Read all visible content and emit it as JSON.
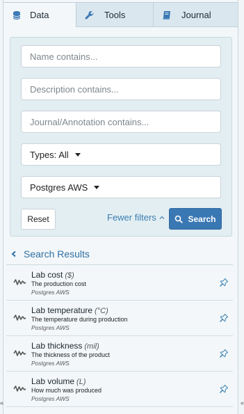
{
  "tabs": [
    {
      "label": "Data",
      "icon": "database-icon",
      "active": true
    },
    {
      "label": "Tools",
      "icon": "wrench-icon",
      "active": false
    },
    {
      "label": "Journal",
      "icon": "book-icon",
      "active": false
    }
  ],
  "filters": {
    "name_placeholder": "Name contains...",
    "name_value": "",
    "description_placeholder": "Description contains...",
    "description_value": "",
    "journal_placeholder": "Journal/Annotation contains...",
    "journal_value": "",
    "types_label": "Types: All",
    "source_label": "Postgres AWS",
    "reset_label": "Reset",
    "fewer_filters_label": "Fewer filters",
    "search_label": "Search"
  },
  "results": {
    "heading": "Search Results",
    "items": [
      {
        "name": "Lab cost",
        "unit": "($)",
        "description": "The production cost",
        "source": "Postgres AWS"
      },
      {
        "name": "Lab temperature",
        "unit": "(°C)",
        "description": "The temperature during production",
        "source": "Postgres AWS"
      },
      {
        "name": "Lab thickness",
        "unit": "(mil)",
        "description": "The thickness of the product",
        "source": "Postgres AWS"
      },
      {
        "name": "Lab volume",
        "unit": "(L)",
        "description": "How much was produced",
        "source": "Postgres AWS"
      }
    ]
  },
  "edges": {
    "left": "«",
    "right": "«"
  },
  "colors": {
    "accent": "#3a78b4",
    "link": "#3b7fb2",
    "panel": "#e3eef2",
    "tab_inactive": "#dbe7ef"
  }
}
